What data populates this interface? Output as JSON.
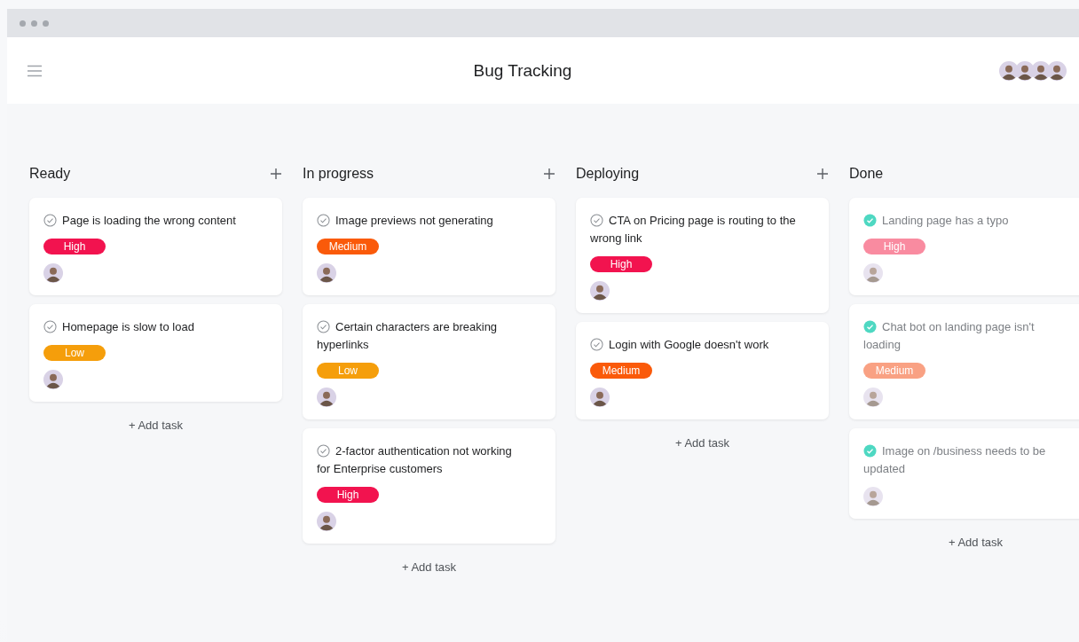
{
  "window": {
    "title": "Bug Tracking"
  },
  "columns": [
    {
      "title": "Ready",
      "kind": "active",
      "tasks": [
        {
          "title": "Page is loading the wrong content",
          "completed": false,
          "priority": {
            "label": "High",
            "color": "#f2134f"
          }
        },
        {
          "title": "Homepage is slow to load",
          "completed": false,
          "priority": {
            "label": "Low",
            "color": "#f59e0b"
          }
        }
      ],
      "add_task": "+ Add task"
    },
    {
      "title": "In progress",
      "kind": "active",
      "tasks": [
        {
          "title": "Image previews not generating",
          "completed": false,
          "priority": {
            "label": "Medium",
            "color": "#fa5a0a"
          }
        },
        {
          "title": "Certain characters are breaking hyperlinks",
          "completed": false,
          "priority": {
            "label": "Low",
            "color": "#f59e0b"
          }
        },
        {
          "title": "2-factor authentication not working for Enterprise customers",
          "completed": false,
          "priority": {
            "label": "High",
            "color": "#f2134f"
          }
        }
      ],
      "add_task": "+ Add task"
    },
    {
      "title": "Deploying",
      "kind": "active",
      "tasks": [
        {
          "title": "CTA on Pricing page is routing to the wrong link",
          "completed": false,
          "priority": {
            "label": "High",
            "color": "#f2134f"
          }
        },
        {
          "title": "Login with Google doesn't work",
          "completed": false,
          "priority": {
            "label": "Medium",
            "color": "#fa5a0a"
          }
        }
      ],
      "add_task": "+ Add task"
    },
    {
      "title": "Done",
      "kind": "complete",
      "tasks": [
        {
          "title": "Landing page has a typo",
          "completed": true,
          "priority": {
            "label": "High",
            "color": "#f98ba0"
          }
        },
        {
          "title": "Chat bot on landing page isn't loading",
          "completed": true,
          "priority": {
            "label": "Medium",
            "color": "#f9a183"
          }
        },
        {
          "title": "Image on /business needs to be updated",
          "completed": true
        }
      ],
      "add_task": "+ Add task"
    }
  ]
}
